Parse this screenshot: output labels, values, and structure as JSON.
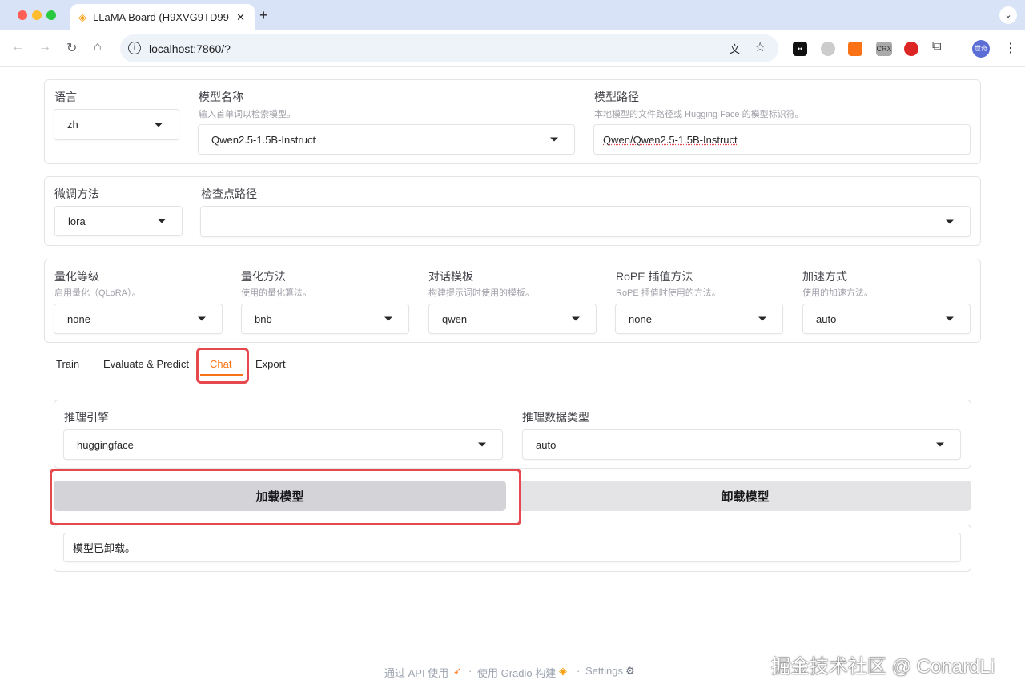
{
  "browser": {
    "tab_title": "LLaMA Board (H9XVG9TD99",
    "url": "localhost:7860/?",
    "profile": "世奇",
    "ext_crx": "CRX"
  },
  "top": {
    "lang_label": "语言",
    "lang_value": "zh",
    "model_name_label": "模型名称",
    "model_name_desc": "输入首单词以检索模型。",
    "model_name_value": "Qwen2.5-1.5B-Instruct",
    "model_path_label": "模型路径",
    "model_path_desc": "本地模型的文件路径或 Hugging Face 的模型标识符。",
    "model_path_value": "Qwen/Qwen2.5-1.5B-Instruct"
  },
  "ft": {
    "method_label": "微调方法",
    "method_value": "lora",
    "ckpt_label": "检查点路径",
    "ckpt_value": ""
  },
  "adv": [
    {
      "label": "量化等级",
      "desc": "启用量化（QLoRA）。",
      "value": "none"
    },
    {
      "label": "量化方法",
      "desc": "使用的量化算法。",
      "value": "bnb"
    },
    {
      "label": "对话模板",
      "desc": "构建提示词时使用的模板。",
      "value": "qwen"
    },
    {
      "label": "RoPE 插值方法",
      "desc": "RoPE 插值时使用的方法。",
      "value": "none"
    },
    {
      "label": "加速方式",
      "desc": "使用的加速方法。",
      "value": "auto"
    }
  ],
  "tabs": [
    "Train",
    "Evaluate & Predict",
    "Chat",
    "Export"
  ],
  "chat": {
    "engine_label": "推理引擎",
    "engine_value": "huggingface",
    "dtype_label": "推理数据类型",
    "dtype_value": "auto",
    "load_btn": "加载模型",
    "unload_btn": "卸载模型",
    "status": "模型已卸载。"
  },
  "footer": {
    "api": "通过 API 使用",
    "sep": "·",
    "gradio": "使用 Gradio 构建",
    "settings": "Settings"
  },
  "watermark": "掘金技术社区 @ ConardLi",
  "colors": {
    "accent": "#f97316",
    "highlight": "#e5484d"
  }
}
